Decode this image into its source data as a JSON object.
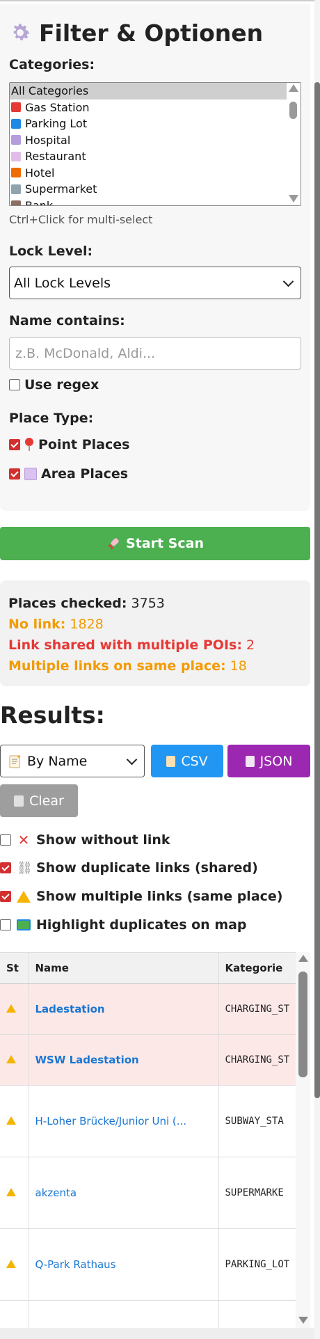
{
  "filter": {
    "title": "Filter & Optionen",
    "categories_label": "Categories:",
    "categories": [
      {
        "label": "All Categories",
        "selected": true,
        "icon": "none"
      },
      {
        "label": "Gas Station",
        "selected": false,
        "icon": "fuel-icon"
      },
      {
        "label": "Parking Lot",
        "selected": false,
        "icon": "parking-icon"
      },
      {
        "label": "Hospital",
        "selected": false,
        "icon": "hospital-icon"
      },
      {
        "label": "Restaurant",
        "selected": false,
        "icon": "restaurant-icon"
      },
      {
        "label": "Hotel",
        "selected": false,
        "icon": "hotel-icon"
      },
      {
        "label": "Supermarket",
        "selected": false,
        "icon": "cart-icon"
      },
      {
        "label": "Bank",
        "selected": false,
        "icon": "bank-icon"
      }
    ],
    "multi_select_hint": "Ctrl+Click for multi-select",
    "lock_level_label": "Lock Level:",
    "lock_level_value": "All Lock Levels",
    "name_contains_label": "Name contains:",
    "name_placeholder": "z.B. McDonald, Aldi...",
    "use_regex_label": "Use regex",
    "use_regex_checked": false,
    "place_type_label": "Place Type:",
    "point_places_label": "Point Places",
    "point_places_checked": true,
    "area_places_label": "Area Places",
    "area_places_checked": true
  },
  "scan_button_label": "Start Scan",
  "stats": {
    "places_checked_label": "Places checked:",
    "places_checked_value": "3753",
    "no_link_label": "No link:",
    "no_link_value": "1828",
    "shared_label": "Link shared with multiple POIs:",
    "shared_value": "2",
    "multiple_label": "Multiple links on same place:",
    "multiple_value": "18"
  },
  "results": {
    "title": "Results:",
    "sort_value": "By Name",
    "csv_label": "CSV",
    "json_label": "JSON",
    "clear_label": "Clear",
    "options": [
      {
        "label": "Show without link",
        "checked": false,
        "icon": "x-icon"
      },
      {
        "label": "Show duplicate links (shared)",
        "checked": true,
        "icon": "link-icon"
      },
      {
        "label": "Show multiple links (same place)",
        "checked": true,
        "icon": "warning-icon"
      },
      {
        "label": "Highlight duplicates on map",
        "checked": false,
        "icon": "map-icon"
      }
    ]
  },
  "table": {
    "headers": [
      "St",
      "Name",
      "Kategorie"
    ],
    "rows": [
      {
        "status": "warning",
        "name": "Ladestation",
        "category": "CHARGING_ST",
        "duplicate": true
      },
      {
        "status": "warning",
        "name": "WSW Ladestation",
        "category": "CHARGING_ST",
        "duplicate": true
      },
      {
        "status": "warning",
        "name": "H-Loher Brücke/Junior Uni (...",
        "category": "SUBWAY_STA",
        "duplicate": false
      },
      {
        "status": "warning",
        "name": "akzenta",
        "category": "SUPERMARKE",
        "duplicate": false
      },
      {
        "status": "warning",
        "name": "Q-Park Rathaus",
        "category": "PARKING_LOT",
        "duplicate": false
      },
      {
        "status": "",
        "name": "",
        "category": "",
        "duplicate": false
      }
    ]
  },
  "colors": {
    "scan_green": "#4caf50",
    "csv_blue": "#2196f3",
    "json_purple": "#9c27b0",
    "clear_gray": "#9e9e9e",
    "warn_orange": "#f29b00",
    "alert_red": "#e53935",
    "link_blue": "#1976d2",
    "dup_row_bg": "#fde8e8"
  }
}
